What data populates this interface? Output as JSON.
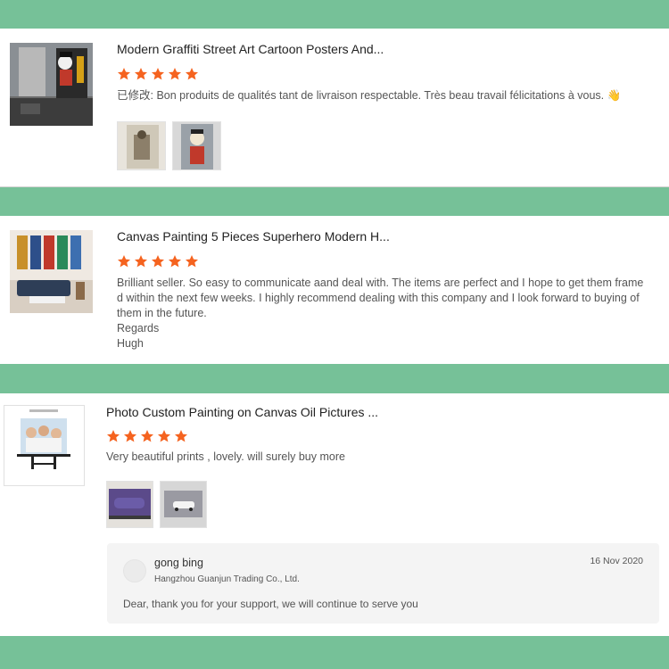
{
  "reviews": [
    {
      "product_title": "Modern Graffiti Street Art Cartoon Posters And...",
      "rating": 5,
      "review_text": "已修改: Bon produits de qualités tant de livraison respectable. Très beau travail félicitations à vous. 👋",
      "photo_count": 2
    },
    {
      "product_title": "Canvas Painting 5 Pieces Superhero Modern H...",
      "rating": 5,
      "review_lines": [
        "Brilliant seller. So easy to communicate aand deal with. The items are perfect and I hope to get them frame",
        "d within the next few weeks. I highly recommend dealing with this company and I look forward to buying of",
        "them in the future.",
        "Regards",
        "Hugh"
      ]
    },
    {
      "product_title": "Photo Custom Painting on Canvas Oil Pictures ...",
      "rating": 5,
      "review_text": "Very beautiful prints , lovely. will surely buy more",
      "photo_count": 2,
      "seller_reply": {
        "name": "gong bing",
        "company": "Hangzhou Guanjun Trading Co., Ltd.",
        "date": "16 Nov 2020",
        "text": "Dear, thank you for your support, we will continue to serve you"
      }
    }
  ],
  "colors": {
    "background": "#76c198",
    "star": "#f5631f",
    "card": "#ffffff"
  },
  "icons": [
    "star-icon",
    "waving-hand-emoji",
    "avatar-placeholder-icon"
  ]
}
